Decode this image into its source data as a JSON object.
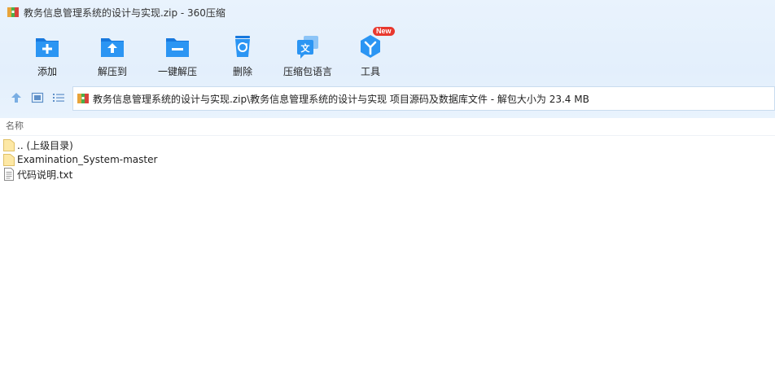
{
  "window": {
    "title": "教务信息管理系统的设计与实现.zip - 360压缩"
  },
  "toolbar": {
    "items": [
      {
        "label": "添加",
        "icon": "add-folder-icon"
      },
      {
        "label": "解压到",
        "icon": "extract-to-icon"
      },
      {
        "label": "一键解压",
        "icon": "one-click-extract-icon"
      },
      {
        "label": "删除",
        "icon": "recycle-bin-icon"
      },
      {
        "label": "压缩包语言",
        "icon": "archive-language-icon"
      },
      {
        "label": "工具",
        "icon": "tools-icon",
        "badge": "New"
      }
    ],
    "accent_color": "#1e8cf0"
  },
  "address": {
    "path": "教务信息管理系统的设计与实现.zip\\教务信息管理系统的设计与实现 项目源码及数据库文件 - 解包大小为 23.4 MB"
  },
  "columns": {
    "name": "名称"
  },
  "files": [
    {
      "name": ".. (上级目录)",
      "type": "folder"
    },
    {
      "name": "Examination_System-master",
      "type": "folder"
    },
    {
      "name": "代码说明.txt",
      "type": "text-file"
    }
  ]
}
